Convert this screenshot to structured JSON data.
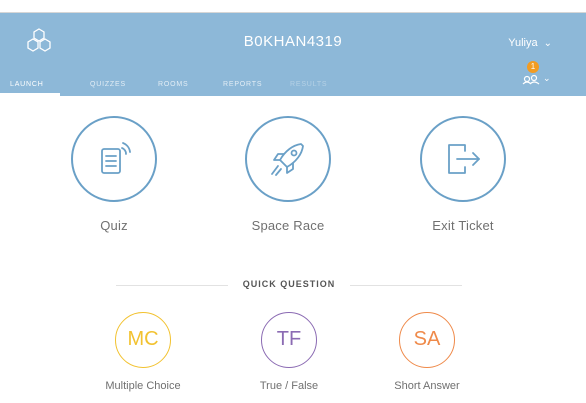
{
  "header": {
    "room_name": "B0KHAN4319",
    "user_name": "Yuliya",
    "notification_count": "1",
    "nav": [
      {
        "label": "LAUNCH"
      },
      {
        "label": "QUIZZES"
      },
      {
        "label": "ROOMS"
      },
      {
        "label": "REPORTS"
      },
      {
        "label": "RESULTS"
      }
    ]
  },
  "launch": [
    {
      "label": "Quiz",
      "icon": "quiz-document-icon"
    },
    {
      "label": "Space Race",
      "icon": "rocket-icon"
    },
    {
      "label": "Exit Ticket",
      "icon": "exit-door-icon"
    }
  ],
  "quick_question": {
    "title": "QUICK QUESTION",
    "items": [
      {
        "abbr": "MC",
        "label": "Multiple Choice",
        "color": "#f2c230"
      },
      {
        "abbr": "TF",
        "label": "True / False",
        "color": "#8b6bb3"
      },
      {
        "abbr": "SA",
        "label": "Short Answer",
        "color": "#ef8a4a"
      }
    ]
  },
  "colors": {
    "header": "#8db8d8",
    "launch_circle": "#6aa0c7",
    "badge": "#f39c22"
  }
}
